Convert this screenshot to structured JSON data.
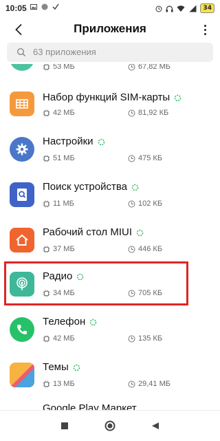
{
  "status_bar": {
    "time": "10:05",
    "battery": "34"
  },
  "header": {
    "title": "Приложения",
    "back_icon": "chevron-left-icon",
    "more_icon": "more-vertical-icon"
  },
  "search": {
    "placeholder": "63 приложения"
  },
  "apps": [
    {
      "name": "",
      "size": "53 МБ",
      "data": "67,82 МБ",
      "color": "#4cc2a0",
      "icon": "app-icon-partial"
    },
    {
      "name": "Набор функций SIM-карты",
      "size": "42 МБ",
      "data": "81,92 КБ",
      "color": "#f59a3c",
      "icon": "sim-toolkit-icon"
    },
    {
      "name": "Настройки",
      "size": "51 МБ",
      "data": "475 КБ",
      "color": "#4a77c9",
      "icon": "settings-gear-icon"
    },
    {
      "name": "Поиск устройства",
      "size": "11 МБ",
      "data": "102 КБ",
      "color": "#3f63c8",
      "icon": "find-device-icon"
    },
    {
      "name": "Рабочий стол MIUI",
      "size": "37 МБ",
      "data": "446 КБ",
      "color": "#f0642f",
      "icon": "home-icon"
    },
    {
      "name": "Радио",
      "size": "34 МБ",
      "data": "705 КБ",
      "color": "#3eb899",
      "icon": "radio-icon"
    },
    {
      "name": "Телефон",
      "size": "42 МБ",
      "data": "135 КБ",
      "color": "#27c16a",
      "icon": "phone-icon"
    },
    {
      "name": "Темы",
      "size": "13 МБ",
      "data": "29,41 МБ",
      "color": "#f4a23b",
      "icon": "themes-icon"
    },
    {
      "name": "Google Play Маркет",
      "size": "",
      "data": "",
      "color": "#ffffff",
      "icon": "play-market-icon"
    }
  ],
  "nav": {
    "recent_icon": "square-icon",
    "home_icon": "circle-icon",
    "back_icon": "triangle-back-icon"
  }
}
